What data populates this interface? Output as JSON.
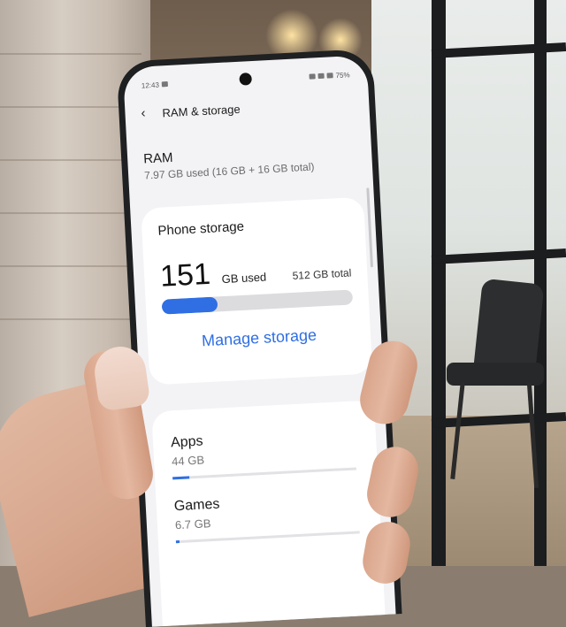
{
  "status_bar": {
    "time": "12:43",
    "battery": "75%"
  },
  "header": {
    "title": "RAM & storage",
    "back_icon": "chevron-left-icon"
  },
  "ram": {
    "label": "RAM",
    "detail": "7.97 GB used (16 GB + 16 GB total)"
  },
  "phone_storage": {
    "title": "Phone storage",
    "used_value": "151",
    "used_unit": "GB used",
    "total": "512 GB total",
    "used_fraction": 0.29,
    "manage_label": "Manage storage"
  },
  "categories": [
    {
      "name": "Apps",
      "size": "44 GB",
      "fraction": 0.09
    },
    {
      "name": "Games",
      "size": "6.7 GB",
      "fraction": 0.02
    }
  ],
  "colors": {
    "accent": "#2f6fe3",
    "screen_bg": "#f3f3f6",
    "card_bg": "#ffffff"
  }
}
